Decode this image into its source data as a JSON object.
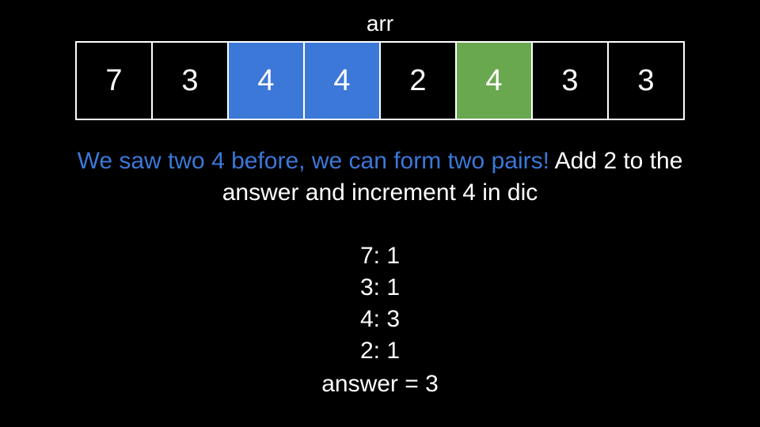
{
  "array_label": "arr",
  "array": [
    {
      "value": "7",
      "state": "none"
    },
    {
      "value": "3",
      "state": "none"
    },
    {
      "value": "4",
      "state": "blue"
    },
    {
      "value": "4",
      "state": "blue"
    },
    {
      "value": "2",
      "state": "none"
    },
    {
      "value": "4",
      "state": "green"
    },
    {
      "value": "3",
      "state": "none"
    },
    {
      "value": "3",
      "state": "none"
    }
  ],
  "colors": {
    "background": "#000000",
    "text": "#ffffff",
    "highlight_blue": "#3b78d8",
    "highlight_green": "#6aa84f"
  },
  "explanation": {
    "highlight": "We saw two 4 before, we can form two pairs!",
    "rest": " Add 2 to the answer and increment 4 in dic"
  },
  "dictionary": [
    "7: 1",
    "3: 1",
    "4: 3",
    "2: 1"
  ],
  "answer_text": "answer = 3"
}
